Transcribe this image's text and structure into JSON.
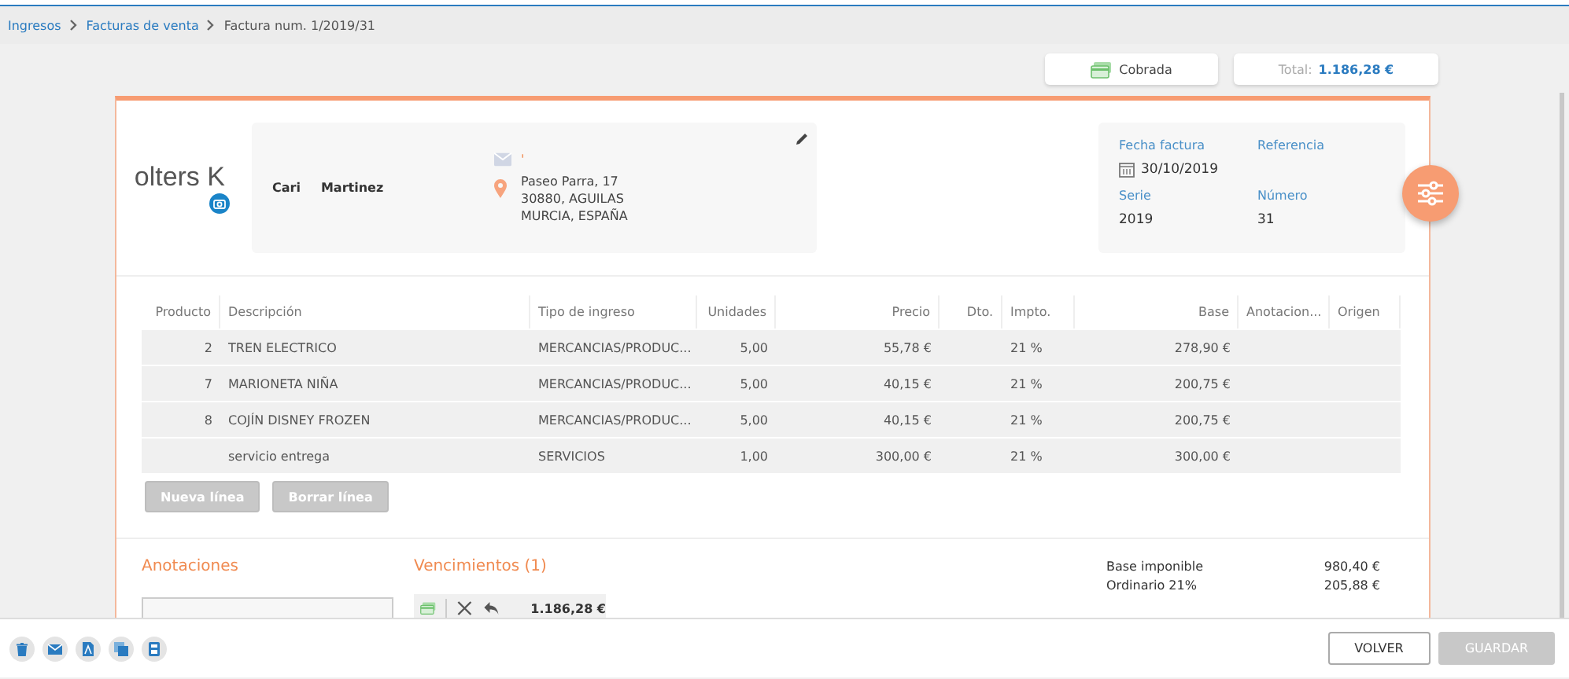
{
  "breadcrumb": [
    {
      "label": "Ingresos",
      "link": true
    },
    {
      "label": "Facturas de venta",
      "link": true
    },
    {
      "label": "Factura num. 1/2019/31",
      "link": false
    }
  ],
  "status": {
    "label": "Cobrada"
  },
  "total": {
    "label": "Total:",
    "value": "1.186,28 €"
  },
  "logo": {
    "text": "olters K"
  },
  "client": {
    "first_name": "Cari",
    "last_name": "Martinez",
    "email": "'",
    "address": [
      "Paseo Parra, 17",
      "30880, AGUILAS",
      "MURCIA, ESPAÑA"
    ]
  },
  "invoice": {
    "fields": [
      {
        "label": "Fecha factura",
        "value": "30/10/2019",
        "kind": "date"
      },
      {
        "label": "Referencia"
      },
      {
        "label": "Serie",
        "value": "2019",
        "kind": "text"
      },
      {
        "label": "Número",
        "value": "31",
        "kind": "text"
      }
    ]
  },
  "table": {
    "columns": [
      "Producto",
      "Descripción",
      "Tipo de ingreso",
      "Unidades",
      "Precio",
      "Dto.",
      "Impto.",
      "Base",
      "Anotacion...",
      "Origen"
    ],
    "rows": [
      [
        "2",
        "TREN ELECTRICO",
        "MERCANCIAS/PRODUC...",
        "5,00",
        "55,78 €",
        "",
        "21 %",
        "278,90 €",
        "",
        ""
      ],
      [
        "7",
        "MARIONETA NIÑA",
        "MERCANCIAS/PRODUC...",
        "5,00",
        "40,15 €",
        "",
        "21 %",
        "200,75 €",
        "",
        ""
      ],
      [
        "8",
        "COJÍN DISNEY FROZEN",
        "MERCANCIAS/PRODUC...",
        "5,00",
        "40,15 €",
        "",
        "21 %",
        "200,75 €",
        "",
        ""
      ],
      [
        "",
        "servicio entrega",
        "SERVICIOS",
        "1,00",
        "300,00 €",
        "",
        "21 %",
        "300,00 €",
        "",
        ""
      ]
    ]
  },
  "line_buttons": [
    {
      "label": "Nueva línea",
      "disabled": true
    },
    {
      "label": "Borrar línea",
      "disabled": true
    }
  ],
  "annotations": {
    "title": "Anotaciones"
  },
  "due_dates": {
    "title": "Vencimientos (1)",
    "items": [
      {
        "amount": "1.186,28 €"
      }
    ]
  },
  "totals": [
    {
      "label": "Base imponible",
      "value": "980,40 €"
    },
    {
      "label": "Ordinario 21%",
      "value": "205,88 €"
    }
  ],
  "footer_actions": [
    {
      "kind": "delete"
    },
    {
      "kind": "email"
    },
    {
      "kind": "pdf"
    },
    {
      "kind": "copy"
    },
    {
      "kind": "receipt"
    }
  ],
  "footer_buttons": [
    {
      "label": "VOLVER",
      "disabled": false
    },
    {
      "label": "GUARDAR",
      "disabled": true
    }
  ]
}
